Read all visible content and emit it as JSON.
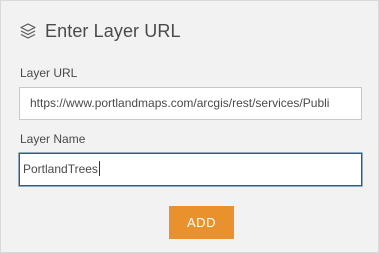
{
  "dialog": {
    "title": "Enter Layer URL",
    "title_icon": "layers-icon"
  },
  "form": {
    "url_label": "Layer URL",
    "url_value": "https://www.portlandmaps.com/arcgis/rest/services/Publi",
    "name_label": "Layer Name",
    "name_value": "PortlandTrees"
  },
  "actions": {
    "add_label": "ADD"
  },
  "colors": {
    "accent": "#e8912d",
    "focus_border": "#2b5d8f",
    "panel_bg": "#f2f2f2"
  }
}
